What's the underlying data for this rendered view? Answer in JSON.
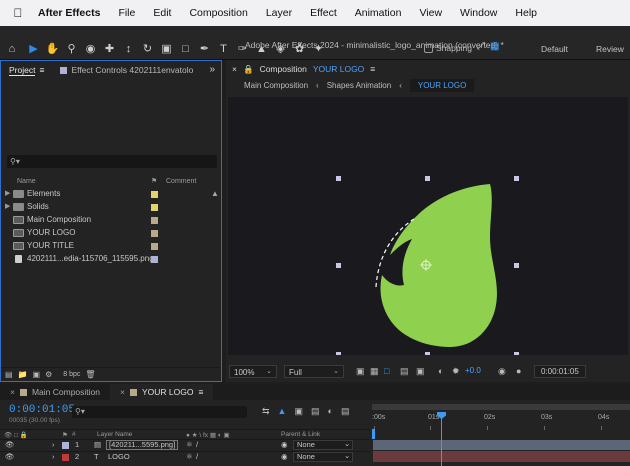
{
  "menubar": {
    "app_name": "After Effects",
    "items": [
      "File",
      "Edit",
      "Composition",
      "Layer",
      "Effect",
      "Animation",
      "View",
      "Window",
      "Help"
    ]
  },
  "window_title": "Adobe After Effects 2024 - minimalistic_logo_animation (converted) *",
  "toolbar": {
    "snapping_label": "Snapping",
    "workspaces": [
      "Default",
      "Review"
    ]
  },
  "project_panel": {
    "tab_project": "Project",
    "tab_effect_controls": "Effect Controls 4202111envatolo",
    "search_icon": "search-icon",
    "col_name": "Name",
    "col_comment": "Comment",
    "items": [
      {
        "name": "Elements",
        "type": "folder",
        "label_color": "#e3d36a"
      },
      {
        "name": "Solids",
        "type": "folder",
        "label_color": "#e3d36a"
      },
      {
        "name": "Main Composition",
        "type": "comp",
        "label_color": "#b8a98a"
      },
      {
        "name": "YOUR LOGO",
        "type": "comp",
        "label_color": "#b8a98a"
      },
      {
        "name": "YOUR TITLE",
        "type": "comp",
        "label_color": "#b8a98a"
      },
      {
        "name": "4202111...edia-115706_115595.png",
        "type": "file",
        "label_color": "#aeb3d6"
      }
    ],
    "bpc": "8 bpc"
  },
  "composition_panel": {
    "tab_prefix": "Composition",
    "tab_name": "YOUR LOGO",
    "breadcrumbs": [
      "Main Composition",
      "Shapes Animation",
      "YOUR LOGO"
    ],
    "zoom": "100%",
    "resolution": "Full",
    "exposure": "+0.0",
    "timecode": "0:00:01:05",
    "logo_color": "#8fd14f"
  },
  "timeline": {
    "tabs": [
      "Main Composition",
      "YOUR LOGO"
    ],
    "current_time": "0:00:01:05",
    "frame_info": "00035 (30.00 fps)",
    "col_layer_name": "Layer Name",
    "col_parent": "Parent & Link",
    "ruler_labels": [
      ":00s",
      "01s",
      "02s",
      "03s",
      "04s"
    ],
    "layers": [
      {
        "num": "1",
        "name": "[420211...5595.png]",
        "parent": "None",
        "label_color": "#aeb3d6"
      },
      {
        "num": "2",
        "name": "LOGO",
        "parent": "None",
        "label_color": "#c0393b"
      }
    ]
  }
}
